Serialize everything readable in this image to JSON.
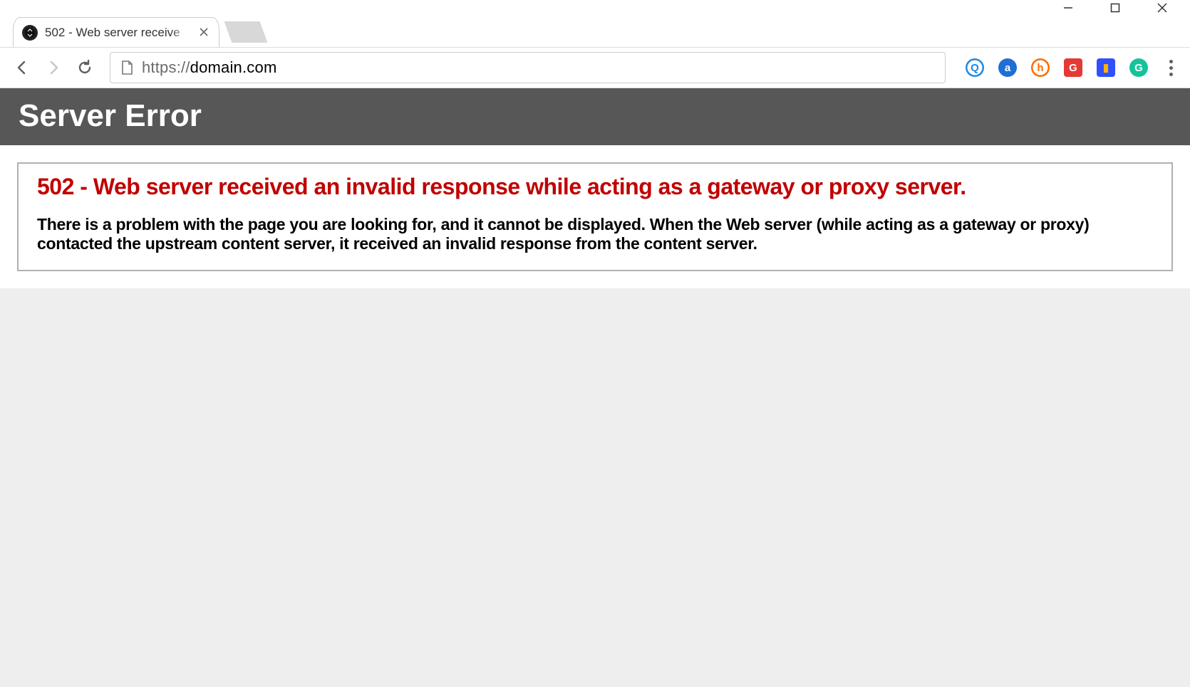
{
  "window": {
    "controls": {
      "minimize": "—",
      "maximize": "□",
      "close": "✕"
    }
  },
  "tab": {
    "title": "502 - Web server receive",
    "favicon": "site-icon"
  },
  "nav": {
    "back": "back",
    "forward": "forward",
    "reload": "reload"
  },
  "omnibox": {
    "protocol": "https://",
    "host": "domain.com"
  },
  "extensions": [
    {
      "name": "ext-blue-q",
      "glyph": "Q",
      "bg": "#ffffff",
      "fg": "#1e88e5",
      "ring": "#1e88e5"
    },
    {
      "name": "ext-amazon",
      "glyph": "a",
      "bg": "#1e6fd6",
      "fg": "#ffffff",
      "ring": "none"
    },
    {
      "name": "ext-honey",
      "glyph": "h",
      "bg": "#ffffff",
      "fg": "#ff6a00",
      "ring": "#ff6a00"
    },
    {
      "name": "ext-grammarly-red",
      "glyph": "G",
      "bg": "#e53935",
      "fg": "#ffffff",
      "ring": "none",
      "square": true
    },
    {
      "name": "ext-lighthouse",
      "glyph": "▮",
      "bg": "#304ffe",
      "fg": "#ffb300",
      "ring": "none",
      "square": true
    },
    {
      "name": "ext-grammarly",
      "glyph": "G",
      "bg": "#15c39a",
      "fg": "#ffffff",
      "ring": "none"
    }
  ],
  "page": {
    "banner_title": "Server Error",
    "error_heading": "502 - Web server received an invalid response while acting as a gateway or proxy server.",
    "error_body": "There is a problem with the page you are looking for, and it cannot be displayed. When the Web server (while acting as a gateway or proxy) contacted the upstream content server, it received an invalid response from the content server."
  }
}
